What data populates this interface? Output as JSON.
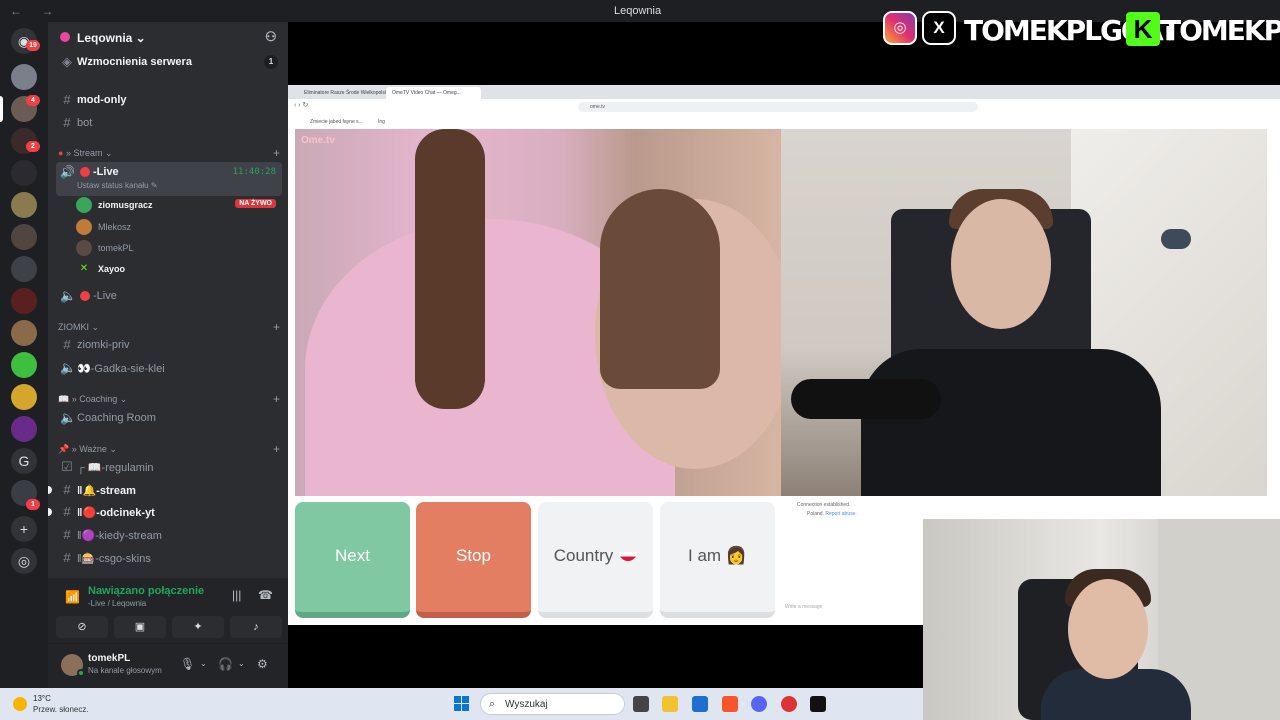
{
  "window": {
    "title": "Leqownia",
    "nav": "← →"
  },
  "rail": {
    "badges": [
      "19",
      "4",
      "2",
      "1"
    ]
  },
  "guild": {
    "name": "Leqownia ⌄",
    "invite_icon": "add-member-icon"
  },
  "boost": {
    "label": "Wzmocnienia serwera",
    "count": "1"
  },
  "channels": {
    "mod_only": "mod-only",
    "bot": "bot",
    "cat_stream": "» Stream ⌄",
    "live_label": "-Live",
    "live_time": "11:40:28",
    "live_status": "Ustaw status kanału ✎",
    "members": [
      {
        "name": "ziomusgracz",
        "badge": "NA ŻYWO"
      },
      {
        "name": "Mlekosz"
      },
      {
        "name": "tomekPL"
      },
      {
        "name": "Xayoo"
      }
    ],
    "live2": "-Live",
    "cat_ziomki": "ZIOMKI ⌄",
    "ziomki_priv": "ziomki-priv",
    "gadka": "👀-Gadka-sie-klei",
    "cat_coaching": "📖 » Coaching ⌄",
    "coaching_room": "Coaching Room",
    "cat_wazne": "📌 » Ważne ⌄",
    "regulamin": "┌ 📖-regulamin",
    "stream": "‖🔔-stream",
    "odcinek": "‖🔴-odcinek-yt",
    "kiedy": "‖🟣-kiedy-stream",
    "csgo": "‖🎰-csgo-skins"
  },
  "voice": {
    "status": "Nawiązano połączenie",
    "channel": "-Live / Leqownia"
  },
  "user": {
    "name": "tomekPL",
    "status": "Na kanale głosowym"
  },
  "overlay": {
    "handle1": "TOMEKPLGOAT",
    "handle2": "TOMEKPL",
    "k": "K"
  },
  "browser": {
    "tab1": "Eliminatore Rasze Środe Wielkopolsk...",
    "tab2": "OmeTV Video Chat — Omeg...",
    "url": "ome.tv",
    "bookmark1": "Zmiecie jabed fayne s...",
    "bookmark2": "Ing"
  },
  "ometv": {
    "logo": "Ome.tv",
    "next": "Next",
    "stop": "Stop",
    "country": "Country",
    "iam": "I am 👩",
    "msg1": "Connection established.",
    "msg2": "Poland.",
    "report": "Report abuse.",
    "input_placeholder": "Write a message"
  },
  "taskbar": {
    "temp": "13°C",
    "weather": "Przew. słonecz.",
    "search": "Wyszukaj"
  }
}
